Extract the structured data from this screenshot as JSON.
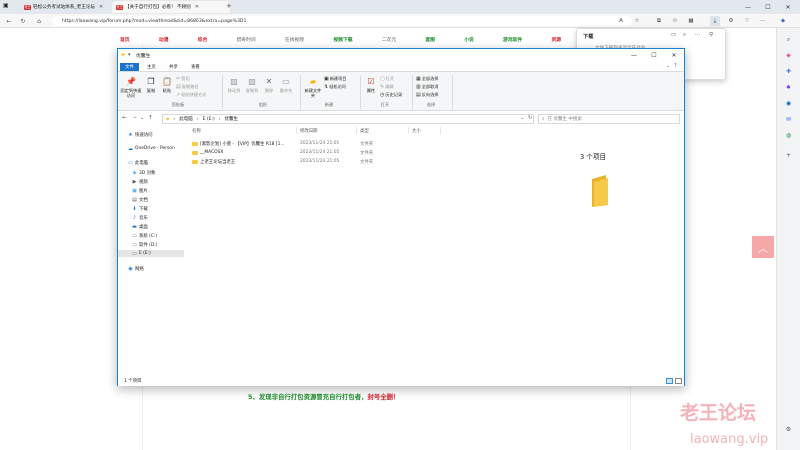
{
  "browser": {
    "tabs": [
      {
        "label": "轻松公务考试站体系_老王论坛",
        "active": false
      },
      {
        "label": "【关于自行打包】必看！ 不顾别",
        "active": true
      }
    ],
    "favicon_label": "老王",
    "new_tab": "+",
    "url": "https://laowang.vip/forum.php?mod=viewthread&tid=86863&extra=page%3D1",
    "window_controls": {
      "minimize": "—",
      "maximize": "☐",
      "close": "✕"
    }
  },
  "site": {
    "nav": [
      "首页",
      "动漫",
      "综合",
      "猎奇时间",
      "在线视频",
      "视频下载",
      "二次元",
      "套图",
      "小说",
      "游戏软件",
      "资源",
      "图子"
    ],
    "notice_prefix": "5、发现非自行打包资源冒充自行打包者，",
    "notice_red": "封号全删！",
    "watermark_cn": "老王论坛",
    "watermark_en": "laowang.vip",
    "back_to_top": "︿"
  },
  "downloads": {
    "title": "下载",
    "subtitle": "文件下载列表显示在此处"
  },
  "explorer": {
    "title": "优馨生",
    "ribbon_tabs": [
      "文件",
      "主页",
      "共享",
      "查看"
    ],
    "ribbon": {
      "pin": "固定到快速访问",
      "copy": "复制",
      "paste": "粘贴",
      "copy_path": "复制路径",
      "paste_shortcut": "粘贴快捷方式",
      "cut": "剪切",
      "clipboard": "剪贴板",
      "move_to": "移动到",
      "copy_to": "复制到",
      "delete": "删除",
      "rename": "重命名",
      "organize": "组织",
      "new_folder": "新建文件夹",
      "new_item": "新建项目",
      "easy_access": "轻松访问",
      "new": "新建",
      "properties": "属性",
      "open": "打开",
      "edit": "编辑",
      "history": "历史记录",
      "open_group": "打开",
      "select_all": "全部选择",
      "select_none": "全部取消",
      "invert": "反向选择",
      "select_group": "选择"
    },
    "path": [
      "此电脑",
      "E (E:)",
      "优馨生"
    ],
    "search_placeholder": "在 优馨生 中搜索",
    "columns": [
      "名称",
      "修改日期",
      "类型",
      "大小"
    ],
    "files": [
      {
        "name": "[紫影企划] 小葱 - 【VIP】优馨生 R18 [1...",
        "date": "2023/11/24 21:01",
        "type": "文件夹"
      },
      {
        "name": "__MACOSX",
        "date": "2023/11/24 21:05",
        "type": "文件夹"
      },
      {
        "name": "上老王论坛当老王",
        "date": "2023/11/24 21:05",
        "type": "文件夹"
      }
    ],
    "nav": [
      {
        "label": "快速访问",
        "icon": "star-icon",
        "indent": 1
      },
      {
        "label": "OneDrive - Person",
        "icon": "cloud-icon",
        "indent": 1
      },
      {
        "label": "此电脑",
        "icon": "computer-icon",
        "indent": 1
      },
      {
        "label": "3D 对象",
        "icon": "cube-icon",
        "indent": 2
      },
      {
        "label": "视频",
        "icon": "video-icon",
        "indent": 2
      },
      {
        "label": "图片",
        "icon": "picture-icon",
        "indent": 2
      },
      {
        "label": "文档",
        "icon": "document-icon",
        "indent": 2
      },
      {
        "label": "下载",
        "icon": "download-icon",
        "indent": 2
      },
      {
        "label": "音乐",
        "icon": "music-icon",
        "indent": 2
      },
      {
        "label": "桌面",
        "icon": "desktop-icon",
        "indent": 2
      },
      {
        "label": "系统 (C:)",
        "icon": "drive-icon",
        "indent": 2
      },
      {
        "label": "软件 (D:)",
        "icon": "drive-icon",
        "indent": 2
      },
      {
        "label": "E (E:)",
        "icon": "drive-icon",
        "indent": 2,
        "selected": true
      },
      {
        "label": "网络",
        "icon": "network-icon",
        "indent": 1
      }
    ],
    "preview_count": "3 个项目",
    "status": "1 个项目"
  },
  "colors": {
    "accent": "#1a73c9",
    "folder": "#f7c948",
    "notice_green": "#1f8f2f",
    "notice_red": "#d8232a"
  }
}
